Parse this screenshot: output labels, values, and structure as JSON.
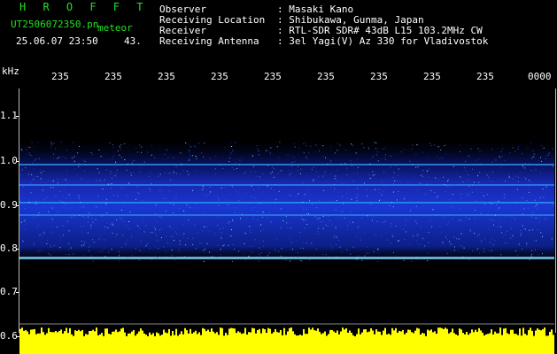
{
  "header": {
    "app_title": "H R O F F T",
    "filename": "UT2506072350.pn",
    "meteor_label": "meteor",
    "timestamp": "25.06.07 23:50",
    "meteor_count": "43."
  },
  "station_info": [
    {
      "label": "Observer",
      "value": ": Masaki Kano"
    },
    {
      "label": "Receiving Location",
      "value": ": Shibukawa, Gunma, Japan"
    },
    {
      "label": "Receiver",
      "value": ": RTL-SDR SDR# 43dB L15 103.2MHz CW"
    },
    {
      "label": "Receiving Antenna",
      "value": ": 3el Yagi(V) Az 330 for Vladivostok"
    }
  ],
  "axes": {
    "unit_label": "kHz",
    "time_ticks": [
      "235",
      "235",
      "235",
      "235",
      "235",
      "235",
      "235",
      "235",
      "235",
      "0000"
    ],
    "freq_ticks": [
      "1.1",
      "1.0",
      "0.9",
      "0.8",
      "0.7",
      "0.6"
    ]
  },
  "colors": {
    "title_green": "#22e022",
    "noise_yellow": "#ffff00",
    "signal_blue": "#1a2ecc",
    "background": "#000000"
  }
}
